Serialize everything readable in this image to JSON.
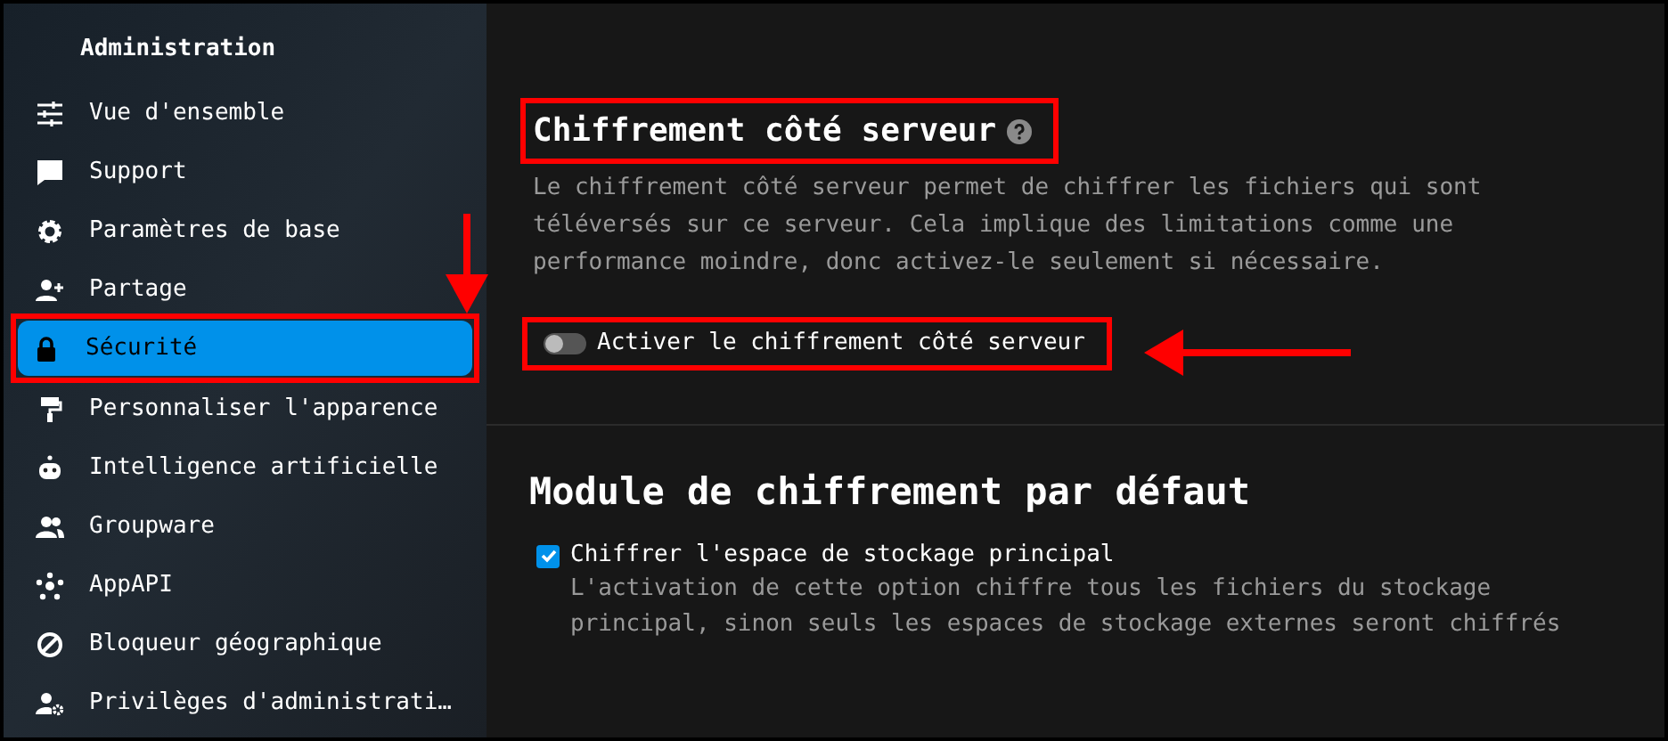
{
  "sidebar": {
    "title": "Administration",
    "items": [
      {
        "label": "Vue d'ensemble",
        "selected": false
      },
      {
        "label": "Support",
        "selected": false
      },
      {
        "label": "Paramètres de base",
        "selected": false
      },
      {
        "label": "Partage",
        "selected": false
      },
      {
        "label": "Sécurité",
        "selected": true
      },
      {
        "label": "Personnaliser l'apparence",
        "selected": false
      },
      {
        "label": "Intelligence artificielle",
        "selected": false
      },
      {
        "label": "Groupware",
        "selected": false
      },
      {
        "label": "AppAPI",
        "selected": false
      },
      {
        "label": "Bloqueur géographique",
        "selected": false
      },
      {
        "label": "Privilèges d'administrati…",
        "selected": false
      }
    ]
  },
  "server_encryption": {
    "title": "Chiffrement côté serveur",
    "description": "Le chiffrement côté serveur permet de chiffrer les fichiers qui sont téléversés sur ce serveur. Cela implique des limitations comme une performance moindre, donc activez-le seulement si nécessaire.",
    "toggle": {
      "label": "Activer le chiffrement côté serveur",
      "on": false
    }
  },
  "default_module": {
    "title": "Module de chiffrement par défaut",
    "checkbox": {
      "label": "Chiffrer l'espace de stockage principal",
      "checked": true
    },
    "hint": "L'activation de cette option chiffre tous les fichiers du stockage principal, sinon seuls les espaces de stockage externes seront chiffrés"
  }
}
